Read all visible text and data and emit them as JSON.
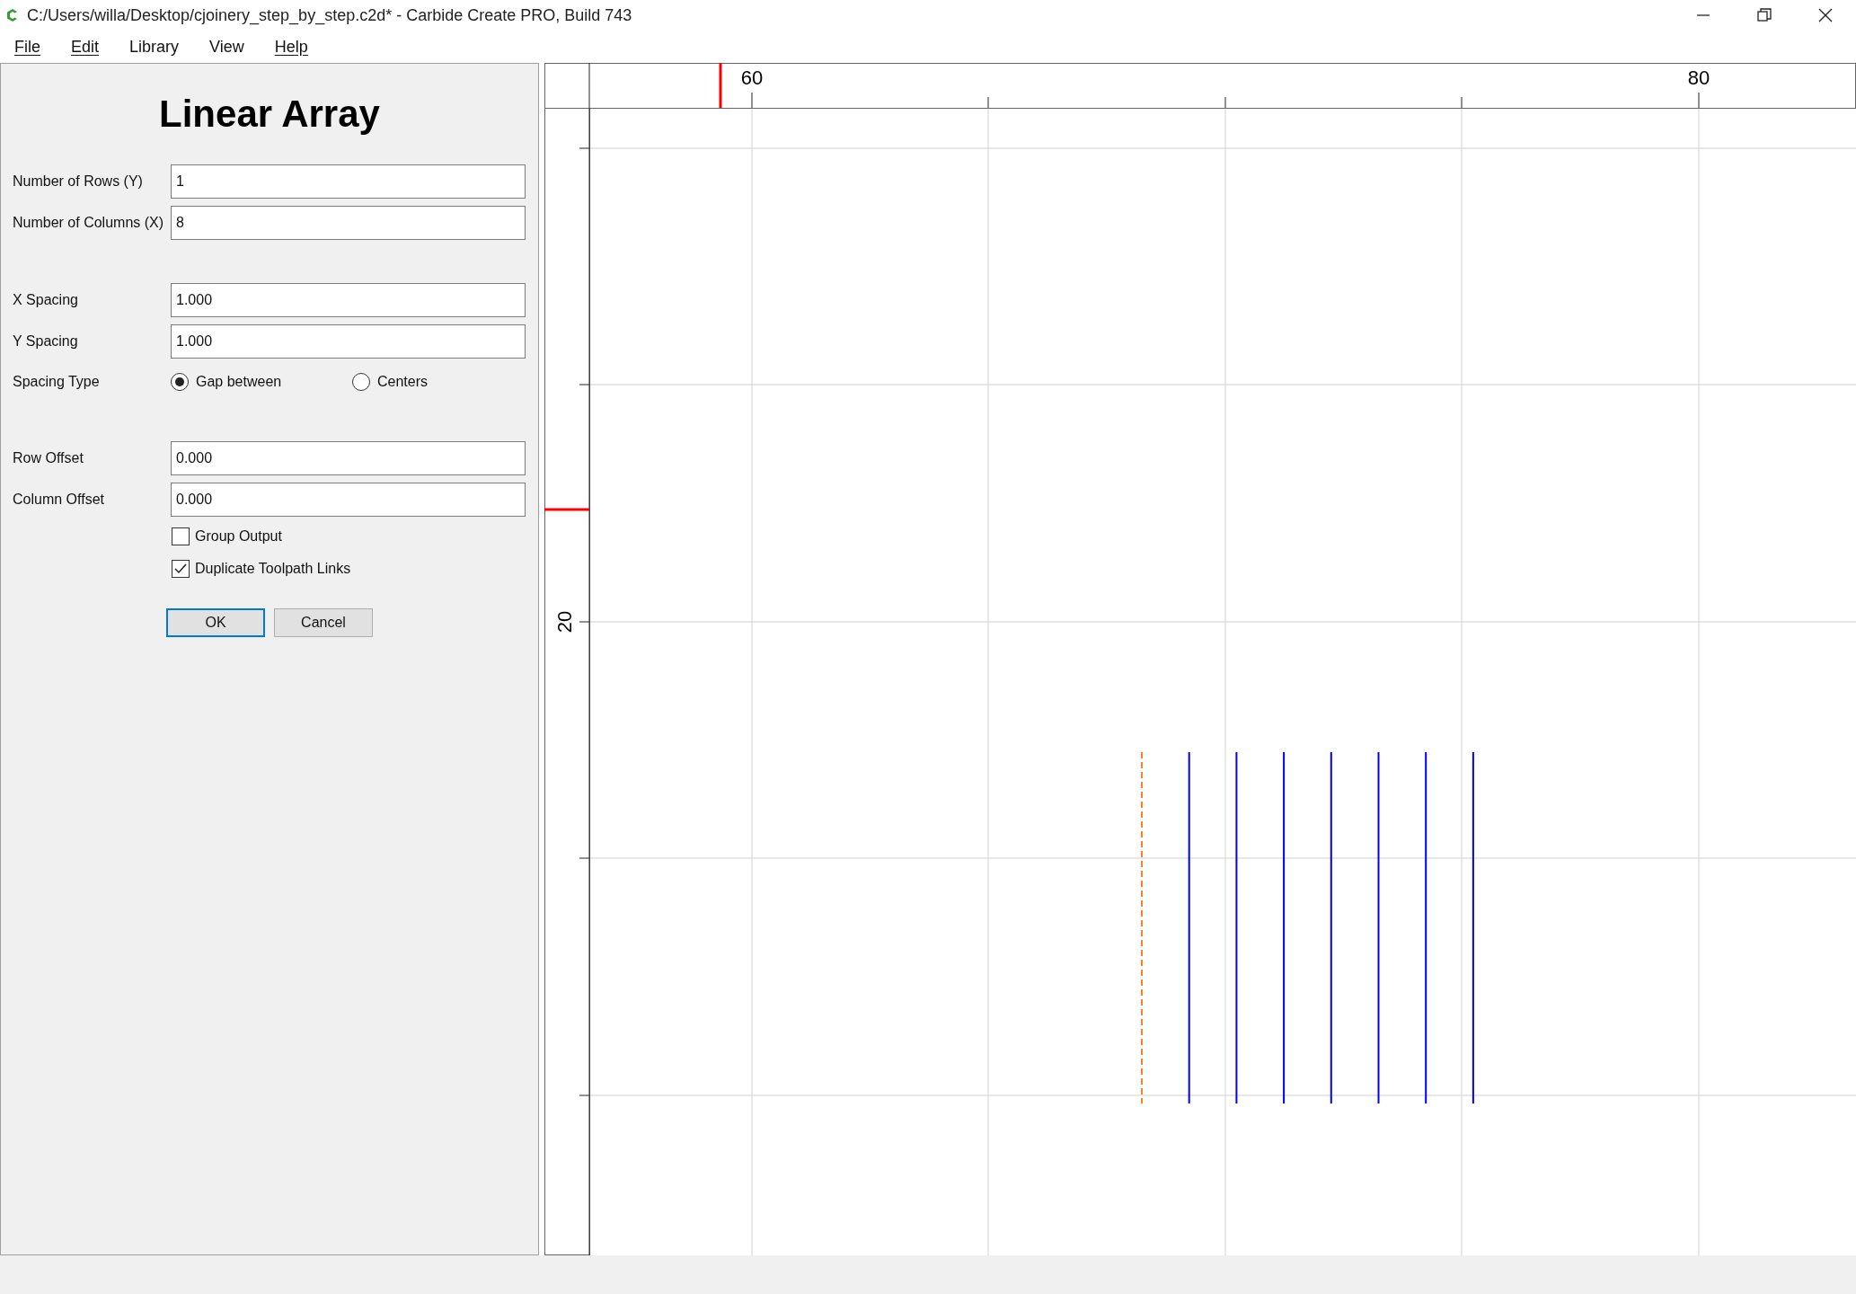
{
  "window": {
    "title": "C:/Users/willa/Desktop/cjoinery_step_by_step.c2d* - Carbide Create PRO, Build 743"
  },
  "menu": [
    {
      "label": "File",
      "underlined": true
    },
    {
      "label": "Edit",
      "underlined": true
    },
    {
      "label": "Library",
      "underlined": false
    },
    {
      "label": "View",
      "underlined": false
    },
    {
      "label": "Help",
      "underlined": true
    }
  ],
  "dialog": {
    "title": "Linear Array",
    "sections": [
      {
        "rows": [
          {
            "kind": "field",
            "label": "Number of Rows (Y)",
            "value": "1"
          },
          {
            "kind": "field",
            "label": "Number of Columns (X)",
            "value": "8"
          }
        ]
      },
      {
        "rows": [
          {
            "kind": "field",
            "label": "X Spacing",
            "value": "1.000"
          },
          {
            "kind": "field",
            "label": "Y Spacing",
            "value": "1.000"
          },
          {
            "kind": "radio",
            "label": "Spacing Type",
            "options": [
              {
                "label": "Gap between",
                "selected": true
              },
              {
                "label": "Centers",
                "selected": false
              }
            ]
          }
        ]
      },
      {
        "rows": [
          {
            "kind": "field",
            "label": "Row Offset",
            "value": "0.000"
          },
          {
            "kind": "field",
            "label": "Column Offset",
            "value": "0.000"
          },
          {
            "kind": "checkbox",
            "label": "Group Output",
            "checked": false
          },
          {
            "kind": "checkbox",
            "label": "Duplicate Toolpath Links",
            "checked": true
          }
        ]
      }
    ],
    "buttons": [
      {
        "label": "OK",
        "default": true
      },
      {
        "label": "Cancel",
        "default": false
      }
    ]
  },
  "canvas": {
    "x_ruler_labels": [
      "60",
      "80"
    ],
    "y_ruler_labels": [
      "20"
    ],
    "shapes": [
      {
        "color": "#ff7f27",
        "dashed": true
      },
      {
        "color": "#0000ff",
        "dashed": false
      },
      {
        "color": "#0000ff",
        "dashed": false
      },
      {
        "color": "#0000ff",
        "dashed": false
      },
      {
        "color": "#0000ff",
        "dashed": false
      },
      {
        "color": "#0000ff",
        "dashed": false
      },
      {
        "color": "#0000ff",
        "dashed": false
      },
      {
        "color": "#0000ff",
        "dashed": false
      }
    ]
  }
}
